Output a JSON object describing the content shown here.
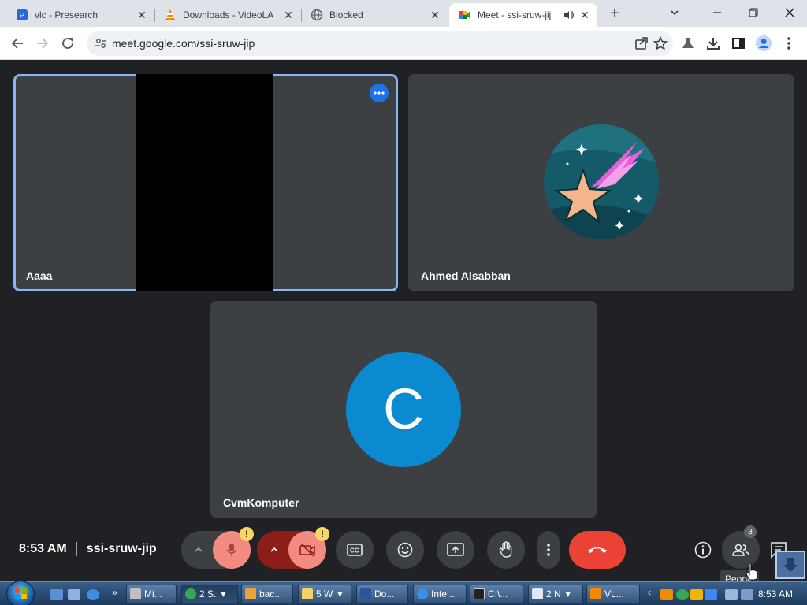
{
  "browser": {
    "tabs": [
      {
        "title": "vlc - Presearch",
        "icon": "presearch-icon",
        "active": false
      },
      {
        "title": "Downloads - VideoLA",
        "icon": "vlc-cone-icon",
        "active": false
      },
      {
        "title": "Blocked",
        "icon": "globe-icon",
        "active": false
      },
      {
        "title": "Meet - ssi-sruw-jij",
        "icon": "meet-icon",
        "active": true
      }
    ],
    "url": "meet.google.com/ssi-sruw-jip"
  },
  "meet": {
    "tiles": [
      {
        "name": "Aaaa",
        "speaking": true
      },
      {
        "name": "Ahmed Alsabban",
        "avatar": "shooting-star-avatar"
      },
      {
        "name": "CvmKomputer",
        "initial": "C"
      }
    ],
    "time": "8:53 AM",
    "meeting_code": "ssi-sruw-jip",
    "controls": {
      "mic_warning": "!",
      "cam_warning": "!",
      "people_tooltip": "People",
      "people_count": "3"
    },
    "colors": {
      "end_call": "#ea4335",
      "mic_off_bg": "#f28b82",
      "cam_off_bg": "#8c1d18",
      "accent": "#8ab4f8"
    }
  },
  "taskbar": {
    "items": [
      "Mi...",
      "2 S.",
      "bac...",
      "5 W",
      "Do...",
      "Inte...",
      "C:\\...",
      "2 N",
      "VL..."
    ],
    "clock": "8:53 AM"
  }
}
